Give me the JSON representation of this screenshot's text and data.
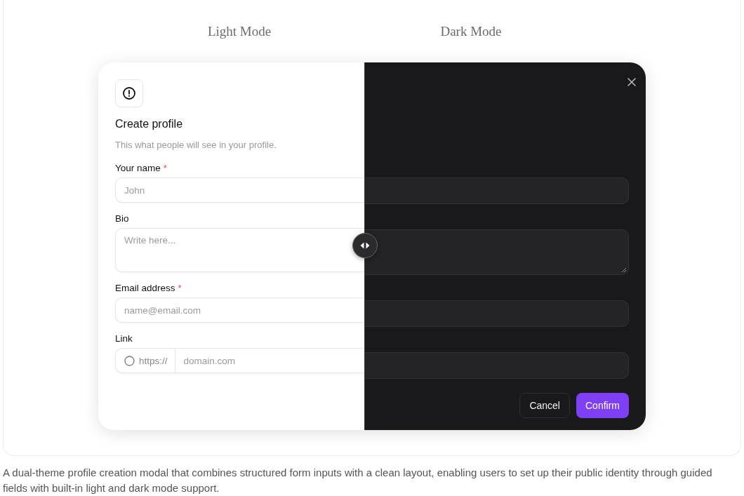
{
  "headings": [
    {
      "label": "Light Mode"
    },
    {
      "label": "Dark Mode"
    }
  ],
  "modal": {
    "title": "Create profile",
    "subtitle": "This what people will see in your profile.",
    "fields": [
      {
        "kind": "input",
        "label": "Your name",
        "required_mark": "*",
        "placeholder": "John"
      },
      {
        "kind": "textarea",
        "label": "Bio",
        "placeholder": "Write here..."
      },
      {
        "kind": "input",
        "label": "Email address",
        "required_mark": "*",
        "placeholder": "name@email.com"
      },
      {
        "kind": "link",
        "label": "Link",
        "prefix": "https://",
        "placeholder": "domain.com"
      }
    ],
    "buttons": [
      {
        "kind": "secondary",
        "label": "Cancel"
      },
      {
        "kind": "primary",
        "label": "Confirm"
      }
    ]
  },
  "caption": "A dual-theme profile creation modal that combines structured form inputs with a clean layout, enabling users to set up their public identity through guided fields with built-in light and dark mode support."
}
